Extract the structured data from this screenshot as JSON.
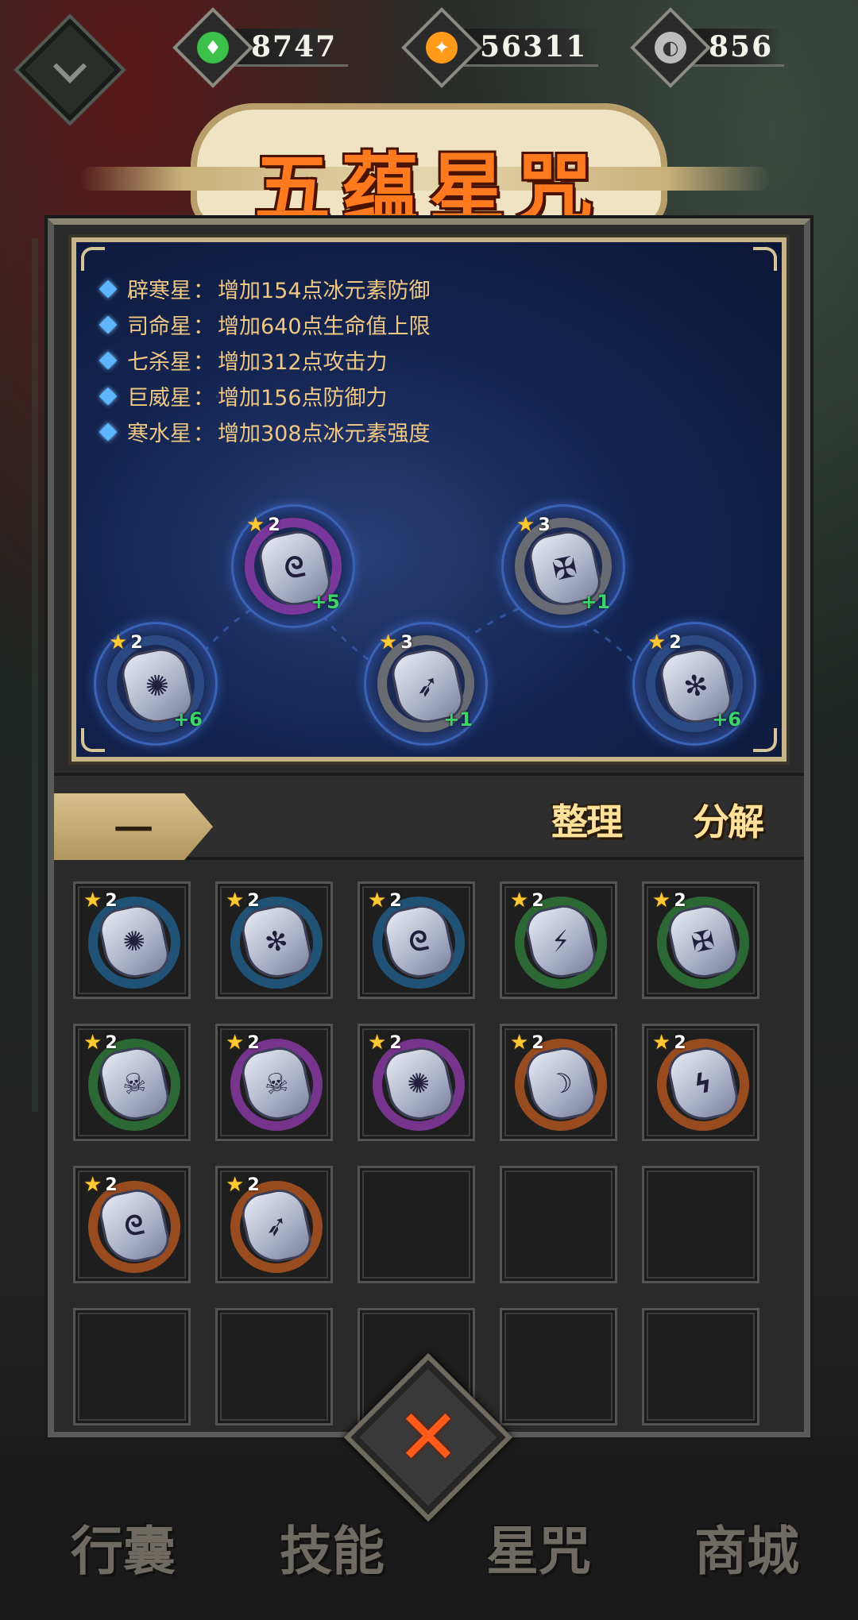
{
  "currencies": [
    {
      "name": "jade",
      "icon": "green-drop-icon",
      "value": "8747",
      "color": "#3cc24a"
    },
    {
      "name": "gold",
      "icon": "gold-coin-icon",
      "value": "56311",
      "color": "#ff9a1a"
    },
    {
      "name": "silver",
      "icon": "silver-swirl-icon",
      "value": "856",
      "color": "#bdbdbd"
    }
  ],
  "title": "五蕴星咒",
  "bonuses": [
    {
      "star": "辟寒星",
      "effect": "增加154点冰元素防御"
    },
    {
      "star": "司命星",
      "effect": "增加640点生命值上限"
    },
    {
      "star": "七杀星",
      "effect": "增加312点攻击力"
    },
    {
      "star": "巨威星",
      "effect": "增加156点防御力"
    },
    {
      "star": "寒水星",
      "effect": "增加308点冰元素强度"
    }
  ],
  "map_nodes": [
    {
      "level": "2",
      "bonus": "+6",
      "symbol": "✺",
      "ring": "#2f4f8c"
    },
    {
      "level": "2",
      "bonus": "+5",
      "symbol": "ᘓ",
      "ring": "#8c3aa8"
    },
    {
      "level": "3",
      "bonus": "+1",
      "symbol": "➶",
      "ring": "#777777"
    },
    {
      "level": "3",
      "bonus": "+1",
      "symbol": "✠",
      "ring": "#777777"
    },
    {
      "level": "2",
      "bonus": "+6",
      "symbol": "✻",
      "ring": "#2f4f8c"
    }
  ],
  "filter": {
    "label": "一"
  },
  "actions": {
    "sort": "整理",
    "decompose": "分解"
  },
  "inventory": [
    {
      "level": "2",
      "symbol": "✺",
      "ring": "#1f5f8a"
    },
    {
      "level": "2",
      "symbol": "✻",
      "ring": "#1f5f8a"
    },
    {
      "level": "2",
      "symbol": "ᘓ",
      "ring": "#1f5f8a"
    },
    {
      "level": "2",
      "symbol": "⚡",
      "ring": "#2f7a3a"
    },
    {
      "level": "2",
      "symbol": "✠",
      "ring": "#2f7a3a"
    },
    {
      "level": "2",
      "symbol": "☠",
      "ring": "#2f7a3a"
    },
    {
      "level": "2",
      "symbol": "☠",
      "ring": "#8c3aa8"
    },
    {
      "level": "2",
      "symbol": "✺",
      "ring": "#8c3aa8"
    },
    {
      "level": "2",
      "symbol": "☽",
      "ring": "#b6561f"
    },
    {
      "level": "2",
      "symbol": "ϟ",
      "ring": "#b6561f"
    },
    {
      "level": "2",
      "symbol": "ᘓ",
      "ring": "#b6561f"
    },
    {
      "level": "2",
      "symbol": "➶",
      "ring": "#b6561f"
    }
  ],
  "nav": {
    "bag": "行囊",
    "skills": "技能",
    "spells": "星咒",
    "shop": "商城"
  },
  "close_label": "✕"
}
